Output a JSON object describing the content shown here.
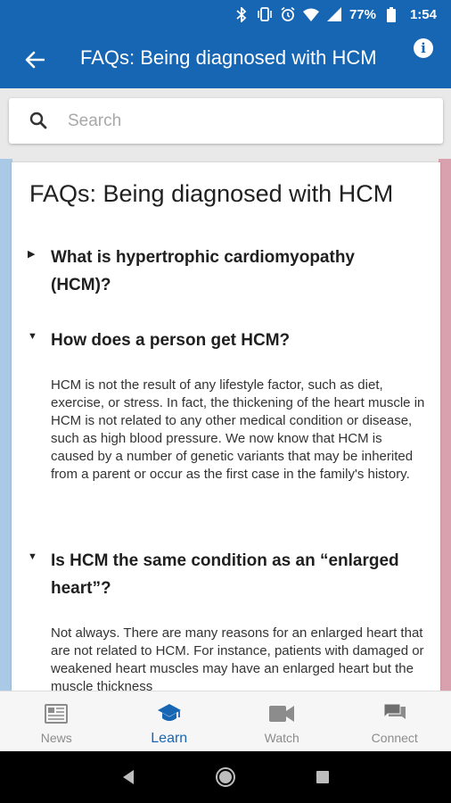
{
  "status": {
    "battery": "77%",
    "time": "1:54"
  },
  "header": {
    "title": "FAQs: Being diagnosed with HCM"
  },
  "search": {
    "placeholder": "Search"
  },
  "card": {
    "title": "FAQs: Being diagnosed with HCM",
    "faqs": [
      {
        "question": "What is hypertrophic cardiomyopathy (HCM)?",
        "expanded": false,
        "answer": ""
      },
      {
        "question": "How does a person get HCM?",
        "expanded": true,
        "answer": "HCM is not the result of any lifestyle factor, such as diet, exercise, or stress. In fact, the thickening of the heart muscle in HCM is not related to any other medical condition or disease, such as high blood pressure. We now know that HCM is caused by a number of genetic variants that may be inherited from a parent or occur as the first case in the family's history."
      },
      {
        "question": "Is HCM the same condition as an “enlarged heart”?",
        "expanded": true,
        "answer": "Not always. There are many reasons for an enlarged heart that are not related to HCM. For instance, patients with damaged or weakened heart muscles may have an enlarged heart but the muscle thickness"
      }
    ]
  },
  "bottom_nav": {
    "items": [
      {
        "label": "News",
        "icon": "news-icon",
        "active": false
      },
      {
        "label": "Learn",
        "icon": "school-icon",
        "active": true
      },
      {
        "label": "Watch",
        "icon": "video-camera-icon",
        "active": false
      },
      {
        "label": "Connect",
        "icon": "chat-icon",
        "active": false
      }
    ]
  },
  "colors": {
    "primary": "#1766b4",
    "left_stripe": "#a9c9e6",
    "right_stripe": "#d9a1ad"
  }
}
